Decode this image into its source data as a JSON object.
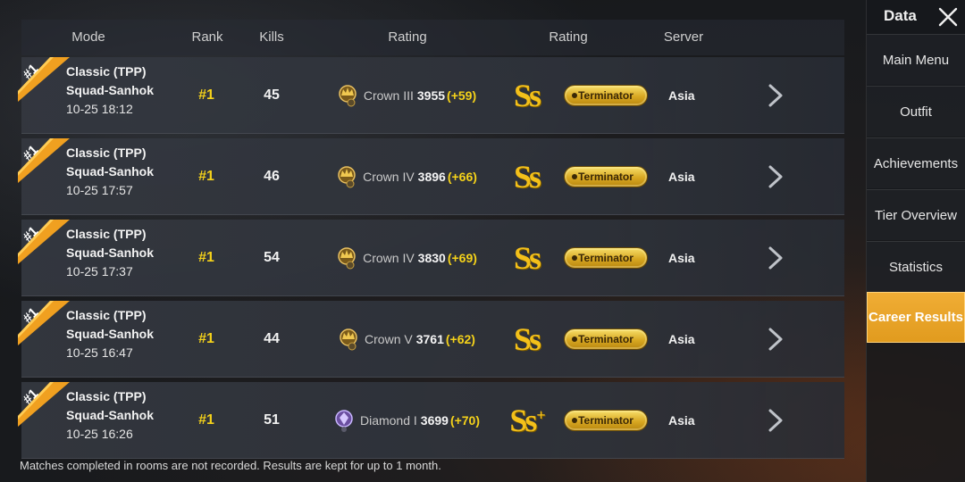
{
  "header": {
    "mode": "Mode",
    "rank": "Rank",
    "kills": "Kills",
    "rating_tier": "Rating",
    "rating_grade": "Rating",
    "server": "Server"
  },
  "rows": [
    {
      "ribbon": "#1",
      "mode": "Classic (TPP)",
      "submode": "Squad-Sanhok",
      "date": "10-25 18:12",
      "rank": "#1",
      "kills": "45",
      "tier_name": "Crown III",
      "score": "3955",
      "delta": "(+59)",
      "tier_icon": "crown-icon",
      "grade": "Ss",
      "grade_plus": "",
      "title": "Terminator",
      "server": "Asia"
    },
    {
      "ribbon": "#1",
      "mode": "Classic (TPP)",
      "submode": "Squad-Sanhok",
      "date": "10-25 17:57",
      "rank": "#1",
      "kills": "46",
      "tier_name": "Crown IV",
      "score": "3896",
      "delta": "(+66)",
      "tier_icon": "crown-icon",
      "grade": "Ss",
      "grade_plus": "",
      "title": "Terminator",
      "server": "Asia"
    },
    {
      "ribbon": "#1",
      "mode": "Classic (TPP)",
      "submode": "Squad-Sanhok",
      "date": "10-25 17:37",
      "rank": "#1",
      "kills": "54",
      "tier_name": "Crown IV",
      "score": "3830",
      "delta": "(+69)",
      "tier_icon": "crown-icon",
      "grade": "Ss",
      "grade_plus": "",
      "title": "Terminator",
      "server": "Asia"
    },
    {
      "ribbon": "#1",
      "mode": "Classic (TPP)",
      "submode": "Squad-Sanhok",
      "date": "10-25 16:47",
      "rank": "#1",
      "kills": "44",
      "tier_name": "Crown V",
      "score": "3761",
      "delta": "(+62)",
      "tier_icon": "crown-icon",
      "grade": "Ss",
      "grade_plus": "",
      "title": "Terminator",
      "server": "Asia"
    },
    {
      "ribbon": "#1",
      "mode": "Classic (TPP)",
      "submode": "Squad-Sanhok",
      "date": "10-25 16:26",
      "rank": "#1",
      "kills": "51",
      "tier_name": "Diamond I",
      "score": "3699",
      "delta": "(+70)",
      "tier_icon": "diamond-icon",
      "grade": "Ss",
      "grade_plus": "+",
      "title": "Terminator",
      "server": "Asia"
    }
  ],
  "footer_note": "Matches completed in rooms are not recorded. Results are kept for up to 1 month.",
  "sidebar": {
    "title": "Data",
    "items": [
      {
        "label": "Main Menu",
        "active": false
      },
      {
        "label": "Outfit",
        "active": false
      },
      {
        "label": "Achievements",
        "active": false
      },
      {
        "label": "Tier Overview",
        "active": false
      },
      {
        "label": "Statistics",
        "active": false
      },
      {
        "label": "Career Results",
        "active": true
      }
    ]
  },
  "colors": {
    "accent": "#e8a126",
    "rank_yellow": "#f5d21a",
    "badge_gold": "#d8a822"
  }
}
